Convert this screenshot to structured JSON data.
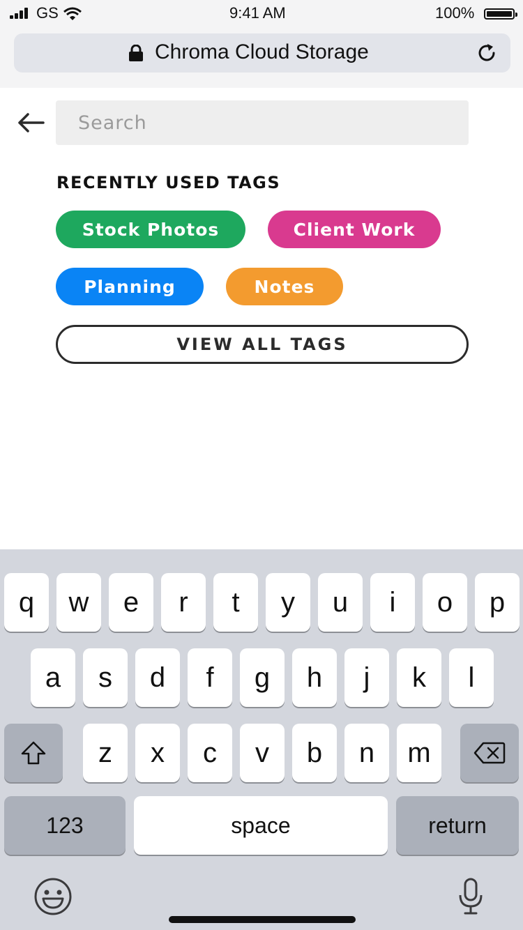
{
  "status_bar": {
    "carrier": "GS",
    "time": "9:41 AM",
    "battery": "100%"
  },
  "browser": {
    "title": "Chroma Cloud Storage",
    "lock_icon": "lock-icon",
    "reload_icon": "reload-icon"
  },
  "search": {
    "placeholder": "Search",
    "value": ""
  },
  "tags_section": {
    "title": "RECENTLY USED TAGS",
    "tags": [
      {
        "label": "Stock Photos",
        "color": "#1ea85e"
      },
      {
        "label": "Client Work",
        "color": "#d93a8f"
      },
      {
        "label": "Planning",
        "color": "#0a84f5"
      },
      {
        "label": "Notes",
        "color": "#f39b2f"
      }
    ],
    "view_all_label": "VIEW ALL TAGS"
  },
  "keyboard": {
    "row1": [
      "q",
      "w",
      "e",
      "r",
      "t",
      "y",
      "u",
      "i",
      "o",
      "p"
    ],
    "row2": [
      "a",
      "s",
      "d",
      "f",
      "g",
      "h",
      "j",
      "k",
      "l"
    ],
    "row3": [
      "z",
      "x",
      "c",
      "v",
      "b",
      "n",
      "m"
    ],
    "numbers_label": "123",
    "space_label": "space",
    "return_label": "return",
    "shift_icon": "shift-icon",
    "delete_icon": "backspace-icon",
    "emoji_icon": "emoji-icon",
    "mic_icon": "microphone-icon"
  }
}
